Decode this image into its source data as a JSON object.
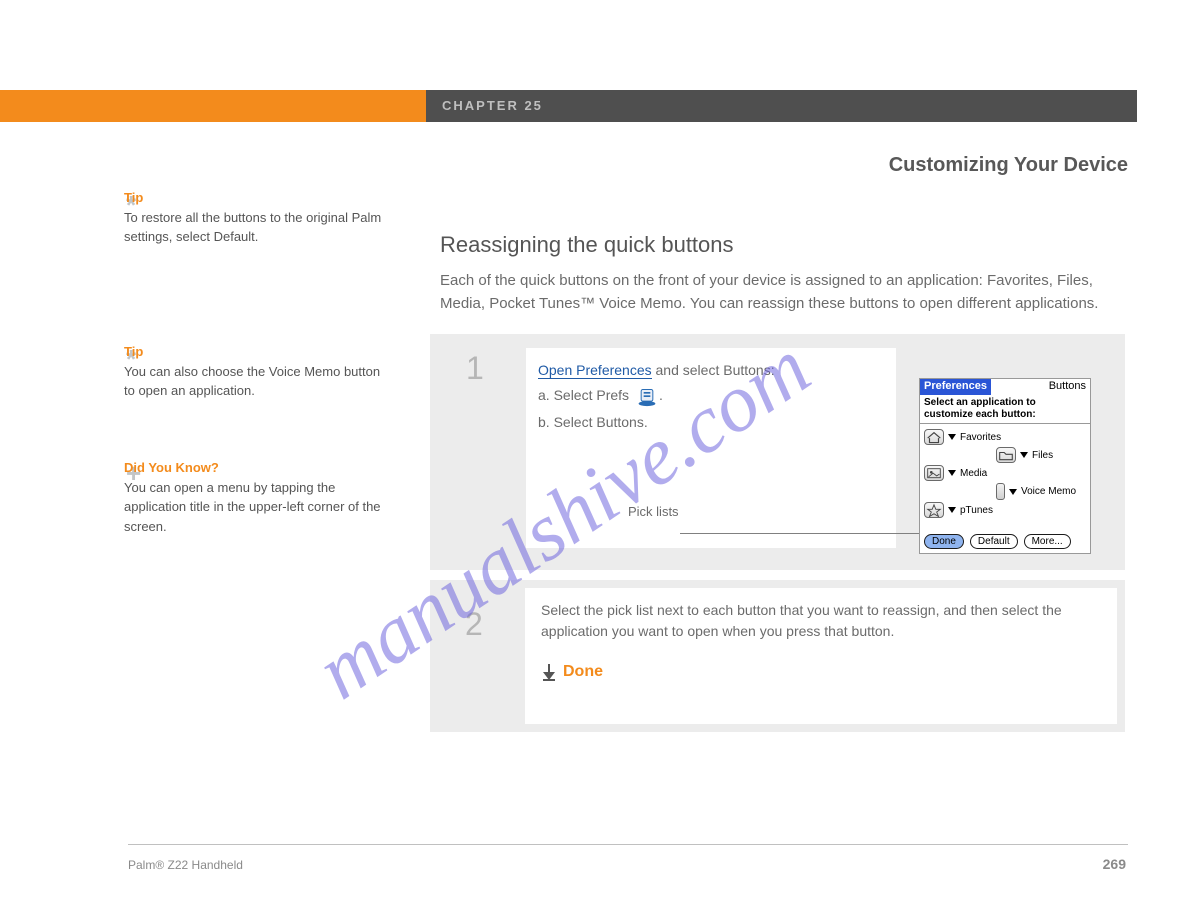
{
  "header": {
    "chapter": "CHAPTER 25",
    "section_title": "Customizing Your Device"
  },
  "tips": {
    "tip1": {
      "label": "Tip",
      "body": "To restore all the buttons to the original Palm settings, select Default."
    },
    "tip2": {
      "label": "Tip",
      "body": "You can also choose the Voice Memo button to open an application."
    },
    "didyou": {
      "label": "Did You Know?",
      "body": "You can open a menu by tapping the application title in the upper-left corner of the screen."
    }
  },
  "main": {
    "heading": "Reassigning the quick buttons",
    "intro": "Each of the quick buttons on the front of your device is assigned to an application: Favorites, Files, Media, Pocket Tunes™ Voice Memo. You can reassign these buttons to open different applications.",
    "step1": {
      "num": "1",
      "open_prefs_link": "Open Preferences",
      "open_prefs_rest": "and select Buttons:",
      "line_a_prefix": "a. Select Prefs",
      "line_b": "b. Select Buttons.",
      "pick_label": "Pick lists"
    },
    "step2": {
      "num": "2",
      "text": "Select the pick list next to each button that you want to reassign, and then select the application you want to open when you press that button.",
      "done": "Done"
    }
  },
  "screenshot": {
    "title": "Preferences",
    "right": "Buttons",
    "sub": "Select an application to customize each button:",
    "rows": {
      "favorites": "Favorites",
      "files": "Files",
      "media": "Media",
      "voice": "Voice Memo",
      "ptunes": "pTunes"
    },
    "buttons": {
      "done": "Done",
      "def": "Default",
      "more": "More..."
    }
  },
  "footer": {
    "name": "Palm® Z22 Handheld",
    "page": "269"
  },
  "watermark": "manualshive.com"
}
